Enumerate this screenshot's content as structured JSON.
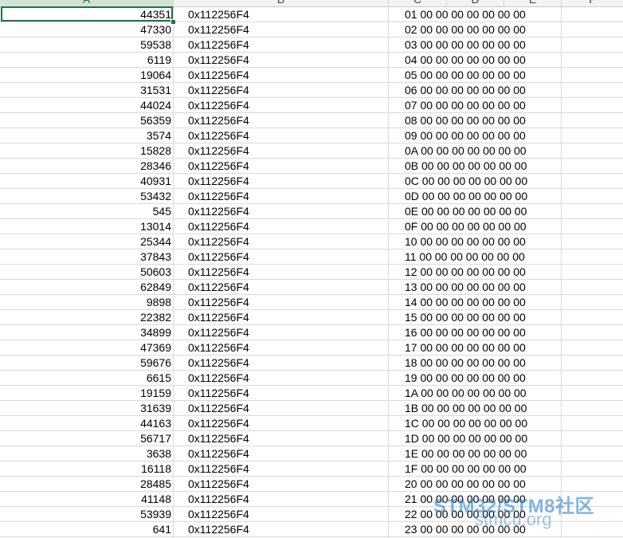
{
  "columns": [
    "A",
    "B",
    "C",
    "D",
    "E",
    "F"
  ],
  "rows": [
    {
      "a": "44351",
      "b": "0x112256F4",
      "c": "01 00 00 00 00 00 00 00"
    },
    {
      "a": "47330",
      "b": "0x112256F4",
      "c": "02 00 00 00 00 00 00 00"
    },
    {
      "a": "59538",
      "b": "0x112256F4",
      "c": "03 00 00 00 00 00 00 00"
    },
    {
      "a": "6119",
      "b": "0x112256F4",
      "c": "04 00 00 00 00 00 00 00"
    },
    {
      "a": "19064",
      "b": "0x112256F4",
      "c": "05 00 00 00 00 00 00 00"
    },
    {
      "a": "31531",
      "b": "0x112256F4",
      "c": "06 00 00 00 00 00 00 00"
    },
    {
      "a": "44024",
      "b": "0x112256F4",
      "c": "07 00 00 00 00 00 00 00"
    },
    {
      "a": "56359",
      "b": "0x112256F4",
      "c": "08 00 00 00 00 00 00 00"
    },
    {
      "a": "3574",
      "b": "0x112256F4",
      "c": "09 00 00 00 00 00 00 00"
    },
    {
      "a": "15828",
      "b": "0x112256F4",
      "c": "0A 00 00 00 00 00 00 00"
    },
    {
      "a": "28346",
      "b": "0x112256F4",
      "c": "0B 00 00 00 00 00 00 00"
    },
    {
      "a": "40931",
      "b": "0x112256F4",
      "c": "0C 00 00 00 00 00 00 00"
    },
    {
      "a": "53432",
      "b": "0x112256F4",
      "c": "0D 00 00 00 00 00 00 00"
    },
    {
      "a": "545",
      "b": "0x112256F4",
      "c": "0E 00 00 00 00 00 00 00"
    },
    {
      "a": "13014",
      "b": "0x112256F4",
      "c": "0F 00 00 00 00 00 00 00"
    },
    {
      "a": "25344",
      "b": "0x112256F4",
      "c": "10 00 00 00 00 00 00 00"
    },
    {
      "a": "37843",
      "b": "0x112256F4",
      "c": "11 00 00 00 00 00 00 00"
    },
    {
      "a": "50603",
      "b": "0x112256F4",
      "c": "12 00 00 00 00 00 00 00"
    },
    {
      "a": "62849",
      "b": "0x112256F4",
      "c": "13 00 00 00 00 00 00 00"
    },
    {
      "a": "9898",
      "b": "0x112256F4",
      "c": "14 00 00 00 00 00 00 00"
    },
    {
      "a": "22382",
      "b": "0x112256F4",
      "c": "15 00 00 00 00 00 00 00"
    },
    {
      "a": "34899",
      "b": "0x112256F4",
      "c": "16 00 00 00 00 00 00 00"
    },
    {
      "a": "47369",
      "b": "0x112256F4",
      "c": "17 00 00 00 00 00 00 00"
    },
    {
      "a": "59676",
      "b": "0x112256F4",
      "c": "18 00 00 00 00 00 00 00"
    },
    {
      "a": "6615",
      "b": "0x112256F4",
      "c": "19 00 00 00 00 00 00 00"
    },
    {
      "a": "19159",
      "b": "0x112256F4",
      "c": "1A 00 00 00 00 00 00 00"
    },
    {
      "a": "31639",
      "b": "0x112256F4",
      "c": "1B 00 00 00 00 00 00 00"
    },
    {
      "a": "44163",
      "b": "0x112256F4",
      "c": "1C 00 00 00 00 00 00 00"
    },
    {
      "a": "56717",
      "b": "0x112256F4",
      "c": "1D 00 00 00 00 00 00 00"
    },
    {
      "a": "3638",
      "b": "0x112256F4",
      "c": "1E 00 00 00 00 00 00 00"
    },
    {
      "a": "16118",
      "b": "0x112256F4",
      "c": "1F 00 00 00 00 00 00 00"
    },
    {
      "a": "28485",
      "b": "0x112256F4",
      "c": "20 00 00 00 00 00 00 00"
    },
    {
      "a": "41148",
      "b": "0x112256F4",
      "c": "21 00 00 00 00 00 00 00"
    },
    {
      "a": "53939",
      "b": "0x112256F4",
      "c": "22 00 00 00 00 00 00 00"
    },
    {
      "a": "641",
      "b": "0x112256F4",
      "c": "23 00 00 00 00 00 00 00"
    }
  ],
  "watermark": {
    "line1": "STM32/STM8社区",
    "line2": "stmcu.org"
  },
  "colors": {
    "selection": "#217346",
    "gridline": "#dadada",
    "watermark": "#1e78c8"
  }
}
